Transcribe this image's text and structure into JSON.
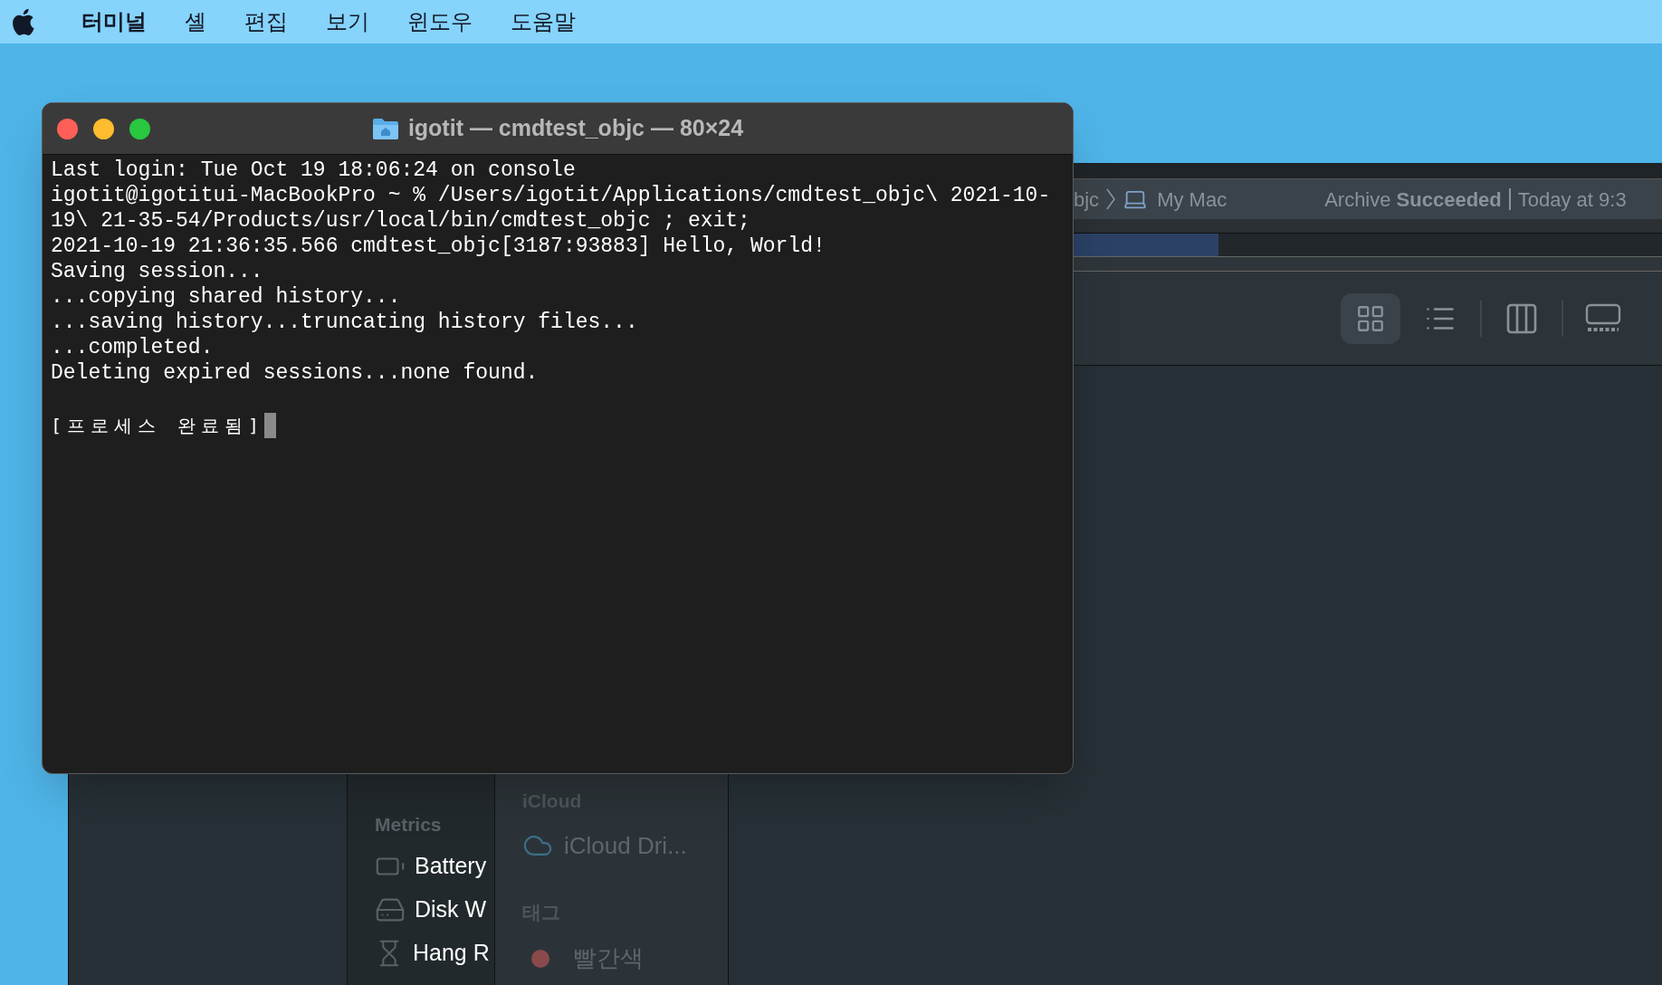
{
  "menu_bar": {
    "items": [
      {
        "label": "터미널",
        "kind": "app"
      },
      {
        "label": "셸",
        "kind": "menu"
      },
      {
        "label": "편집",
        "kind": "menu"
      },
      {
        "label": "보기",
        "kind": "menu"
      },
      {
        "label": "윈도우",
        "kind": "menu"
      },
      {
        "label": "도움말",
        "kind": "menu"
      }
    ]
  },
  "xcode_window": {
    "breadcrumb": [
      "bjc",
      "My Mac"
    ],
    "status": "Archive **Succeeded**",
    "status_time": "Today at 9:3",
    "view_buttons": [
      {
        "kind": "grid",
        "selected": true
      },
      {
        "kind": "list",
        "selected": false
      },
      {
        "kind": "columns",
        "selected": false
      },
      {
        "kind": "gallery",
        "selected": false
      }
    ]
  },
  "terminal": {
    "title": "igotit — cmdtest_objc — 80×24",
    "lines": [
      "Last login: Tue Oct 19 18:06:24 on console",
      "igotit@igotitui-MacBookPro ~ % /Users/igotit/Applications/cmdtest_objc\\ 2021-10-",
      "19\\ 21-35-54/Products/usr/local/bin/cmdtest_objc ; exit;",
      "2021-10-19 21:36:35.566 cmdtest_objc[3187:93883] Hello, World!",
      "Saving session...",
      "...copying shared history...",
      "...saving history...truncating history files...",
      "...completed.",
      "Deleting expired sessions...none found."
    ],
    "final_line": "[프로세스 완료됨]"
  },
  "sidebar": {
    "metrics": {
      "header": "Metrics",
      "items": [
        {
          "label": "Battery",
          "kind": "battery"
        },
        {
          "label": "Disk W",
          "kind": "disk"
        },
        {
          "label": "Hang R",
          "kind": "hourglass"
        }
      ]
    },
    "icloud": {
      "header": "iCloud",
      "items": [
        "iCloud Dri..."
      ]
    },
    "tags": {
      "header": "태그",
      "items": [
        {
          "label": "빨간색",
          "color": "#8a4a4b"
        }
      ]
    }
  }
}
